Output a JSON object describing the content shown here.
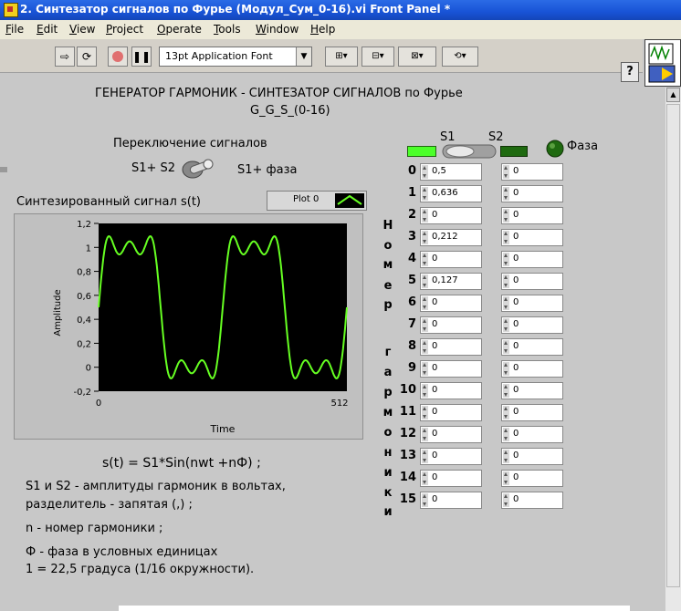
{
  "window": {
    "title": "2. Синтезатор сигналов по Фурье (Модул_Сум_0-16).vi Front Panel *"
  },
  "menu": [
    "File",
    "Edit",
    "View",
    "Project",
    "Operate",
    "Tools",
    "Window",
    "Help"
  ],
  "toolbar": {
    "font_select": "13pt Application Font",
    "help_label": "?"
  },
  "panel": {
    "heading_line1": "ГЕНЕРАТОР  ГАРМОНИК - СИНТЕЗАТОР  СИГНАЛОВ по Фурье",
    "heading_line2": "G_G_S_(0-16)",
    "switch_title": "Переключение  сигналов",
    "switch_left_label": "S1+ S2",
    "switch_right_label": "S1+ фаза",
    "graph_title": "Синтезированный  сигнал  s(t)",
    "plot_legend": "Plot 0",
    "col_s1": "S1",
    "col_s2": "S2",
    "phase_label": "Фаза",
    "vertical_label": [
      "Н",
      "о",
      "м",
      "е",
      "р",
      "",
      "",
      "г",
      "а",
      "р",
      "м",
      "о",
      "н",
      "и",
      "к",
      "и"
    ],
    "formula": "s(t) = S1*Sin(nwt  +nФ) ;",
    "desc1": "S1 и S2 - амплитуды гармоник в вольтах,",
    "desc2": "разделитель - запятая (,) ;",
    "desc3": "n - номер гармоники ;",
    "desc4": "Ф - фаза  в условных  единицах",
    "desc5": "1 = 22,5 градуса (1/16 окружности)."
  },
  "harmonics": {
    "index": [
      "0",
      "1",
      "2",
      "3",
      "4",
      "5",
      "6",
      "7",
      "8",
      "9",
      "10",
      "11",
      "12",
      "13",
      "14",
      "15"
    ],
    "s1": [
      "0,5",
      "0,636",
      "0",
      "0,212",
      "0",
      "0,127",
      "0",
      "0",
      "0",
      "0",
      "0",
      "0",
      "0",
      "0",
      "0",
      "0"
    ],
    "s2": [
      "0",
      "0",
      "0",
      "0",
      "0",
      "0",
      "0",
      "0",
      "0",
      "0",
      "0",
      "0",
      "0",
      "0",
      "0",
      "0"
    ]
  },
  "chart_data": {
    "type": "line",
    "xlabel": "Time",
    "ylabel": "Amplitude",
    "xlim": [
      0,
      512
    ],
    "ylim": [
      -0.2,
      1.2
    ],
    "yticks": [
      "1,2",
      "1",
      "0,8",
      "0,6",
      "0,4",
      "0,2",
      "0",
      "-0,2"
    ],
    "xticks": [
      "0",
      "512"
    ],
    "series": [
      {
        "name": "Plot 0",
        "color": "#66ff22",
        "formula": "0.5 + 0.636*sin(wt) + 0.212*sin(3wt) + 0.127*sin(5wt), 2 periods over 512 samples"
      }
    ],
    "background": "#000000",
    "grid": false
  },
  "colors": {
    "plot_bg": "#000000",
    "trace": "#66ff22",
    "led_on": "#4cff2a",
    "led_off": "#1f6a10",
    "panel": "#c8c8c8"
  }
}
